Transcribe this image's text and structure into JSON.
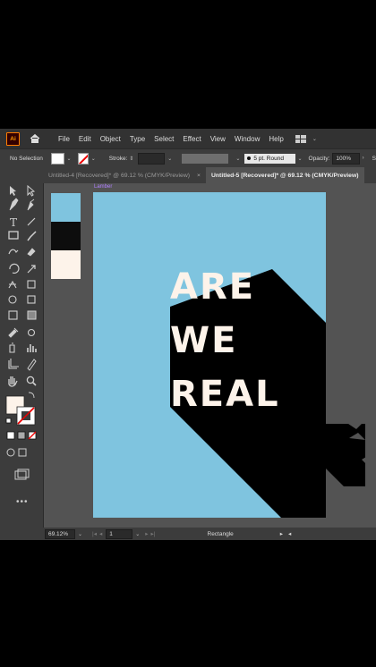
{
  "app": {
    "logo": "Ai",
    "menu": [
      "File",
      "Edit",
      "Object",
      "Type",
      "Select",
      "Effect",
      "View",
      "Window",
      "Help"
    ]
  },
  "controlbar": {
    "selection": "No Selection",
    "stroke_label": "Stroke:",
    "brush": "5 pt. Round",
    "opacity_label": "Opacity:",
    "opacity_value": "100%",
    "style_label": "S"
  },
  "tabs": [
    {
      "label": "Untitled-4 [Recovered]* @ 69.12 % (CMYK/Preview)",
      "active": false
    },
    {
      "label": "Untitled-5 [Recovered]* @ 69.12 % (CMYK/Preview)",
      "active": true
    }
  ],
  "tab_close": "×",
  "artboard": {
    "name": "Lamber",
    "background": "#7fc4df",
    "lines": [
      "ARE",
      "WE",
      "REAL"
    ],
    "text_color": "#fdf3ea",
    "shadow_color": "#000000"
  },
  "swatches": [
    "#7fc4df",
    "#0d0d0d",
    "#fdf3ea"
  ],
  "statusbar": {
    "zoom": "69.12%",
    "artboard_number": "1",
    "current_tool": "Rectangle"
  },
  "icons": [
    "home-icon",
    "selection-tool-icon",
    "direct-selection-tool-icon",
    "pen-tool-icon",
    "type-tool-icon",
    "rectangle-tool-icon",
    "paintbrush-tool-icon",
    "eraser-tool-icon",
    "rotate-tool-icon",
    "scale-tool-icon",
    "eyedropper-tool-icon",
    "graph-tool-icon",
    "hand-tool-icon",
    "zoom-tool-icon",
    "fill-swatch-icon",
    "stroke-swatch-icon",
    "more-tools-icon"
  ]
}
